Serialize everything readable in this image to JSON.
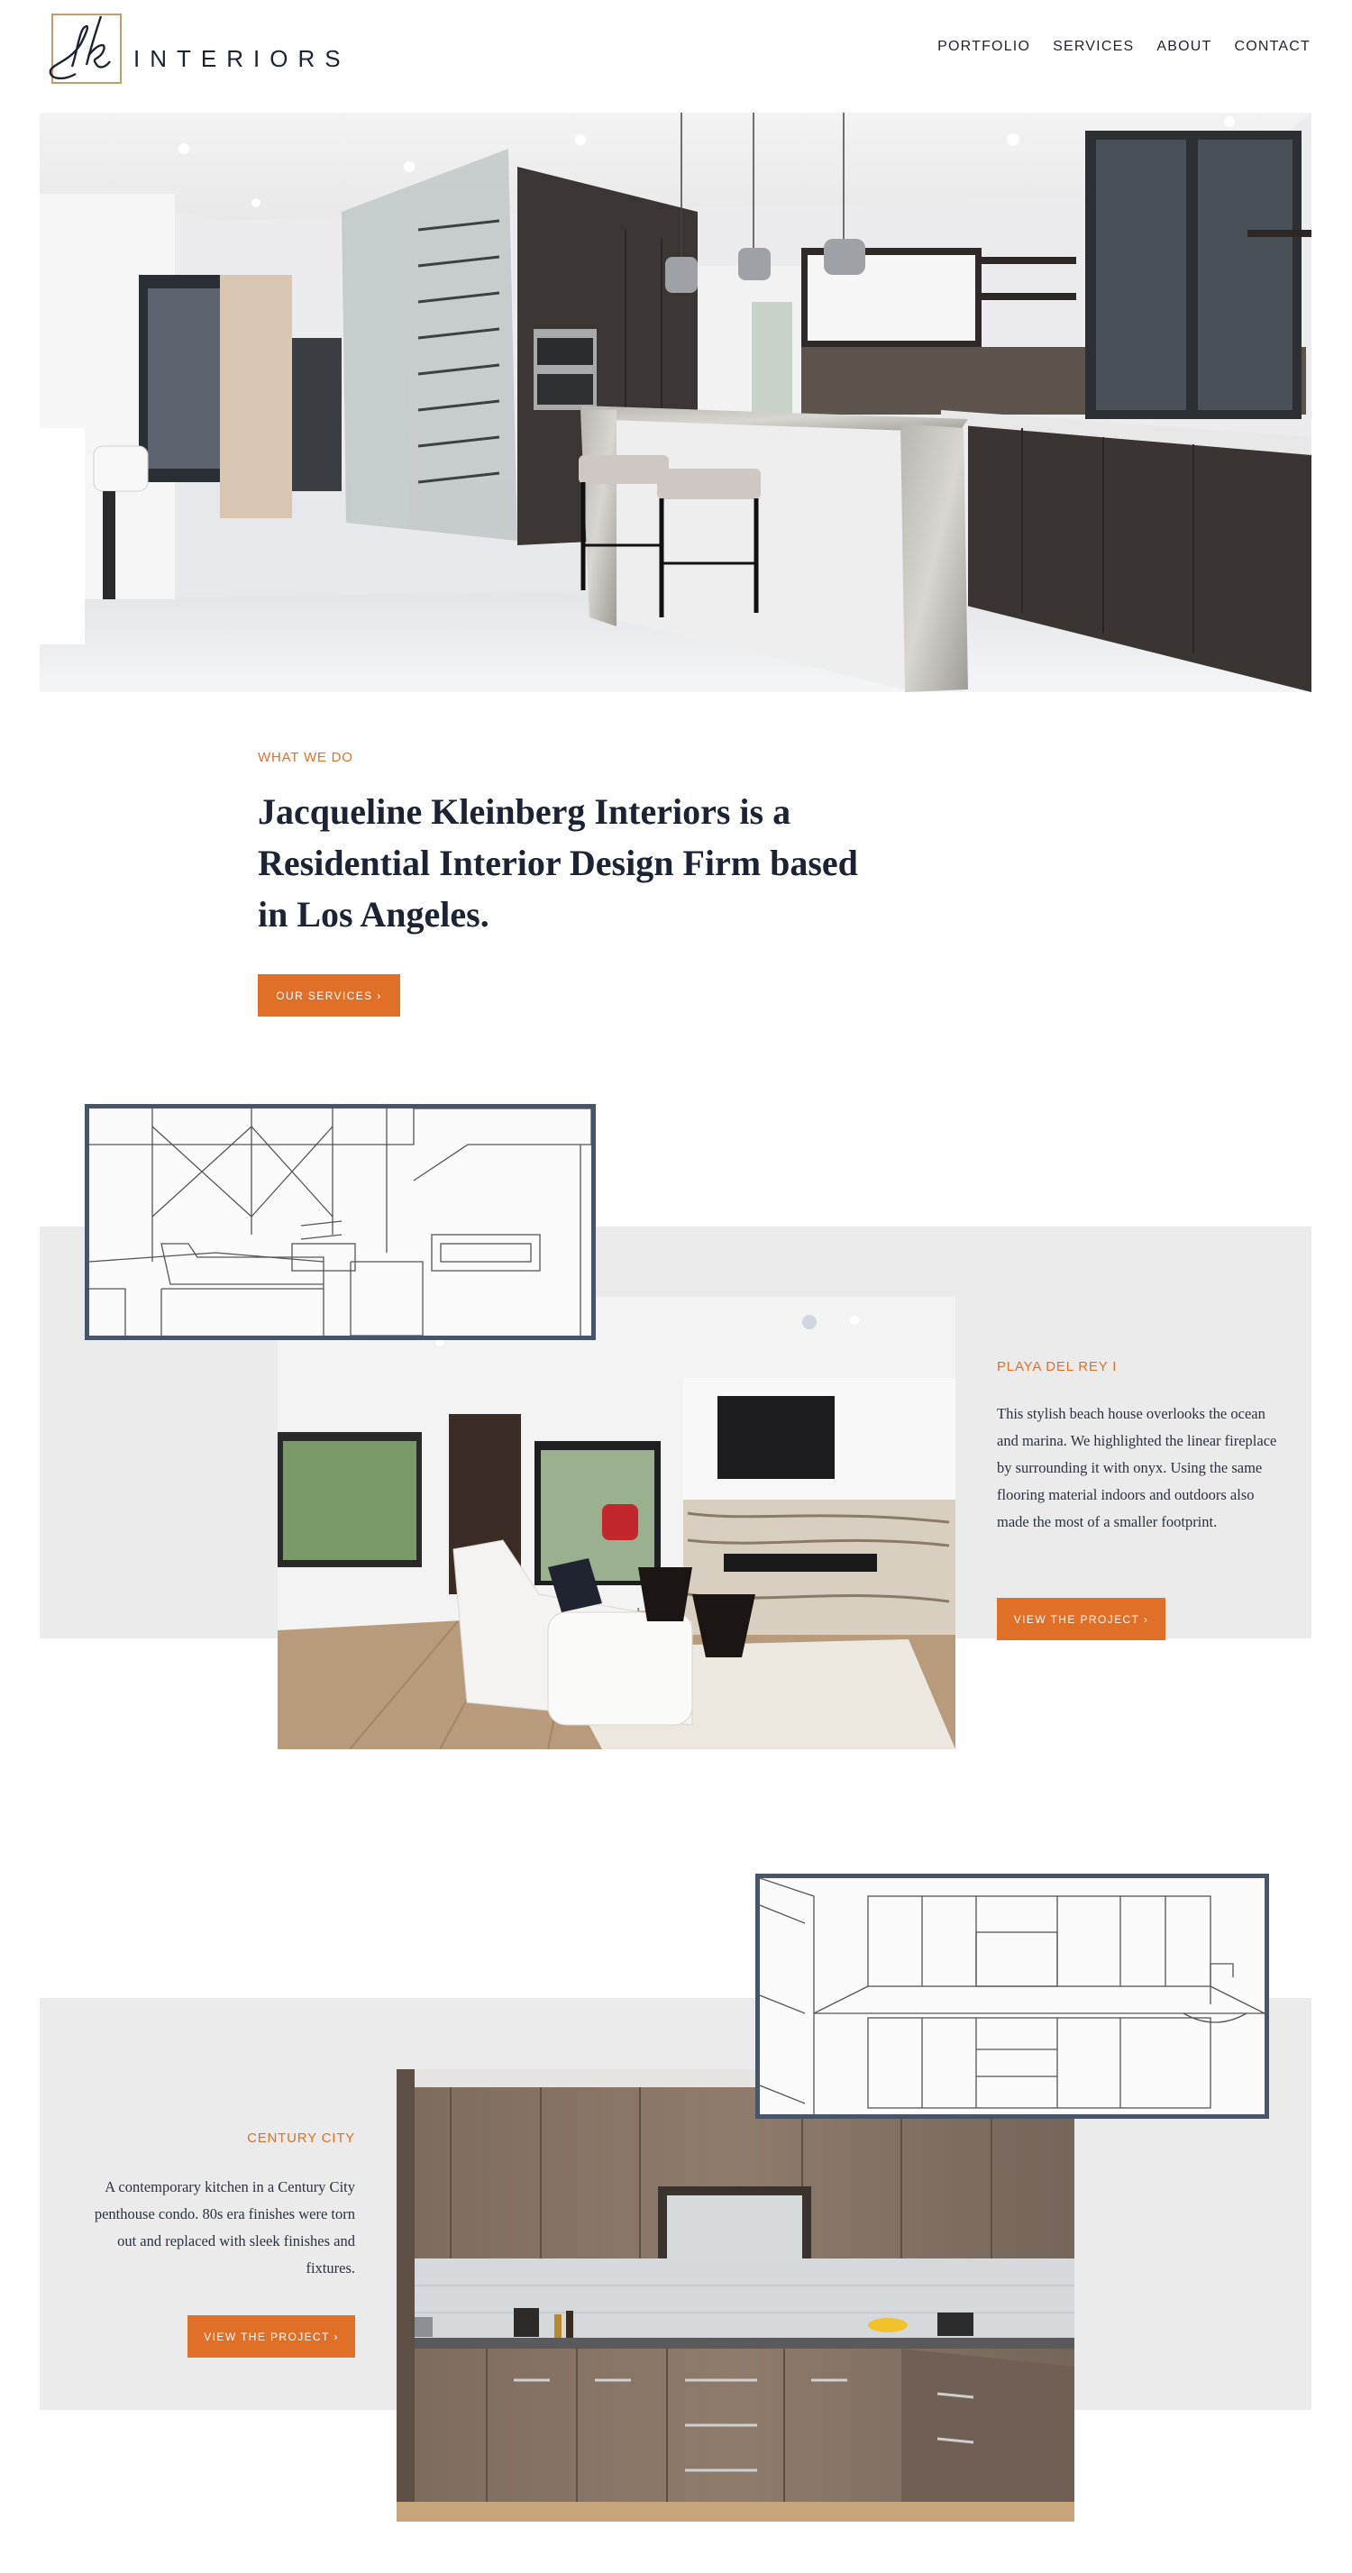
{
  "header": {
    "logo_mark": "jk",
    "logo_word": "INTERIORS",
    "nav": [
      "PORTFOLIO",
      "SERVICES",
      "ABOUT",
      "CONTACT"
    ]
  },
  "intro": {
    "eyebrow": "WHAT WE DO",
    "headline": "Jacqueline Kleinberg Interiors is a Residential Interior Design Firm based in Los Angeles.",
    "button": "OUR SERVICES ›"
  },
  "projects": [
    {
      "eyebrow": "PLAYA DEL REY I",
      "body": "This stylish beach house overlooks the ocean and marina. We highlighted the linear fireplace by surrounding it with onyx. Using the same flooring material indoors and outdoors also made the most of a smaller footprint.",
      "button": "VIEW THE PROJECT ›"
    },
    {
      "eyebrow": "CENTURY CITY",
      "body": "A contemporary kitchen in a Century City penthouse condo. 80s era finishes were torn out and replaced with sleek finishes and fixtures.",
      "button": "VIEW THE PROJECT ›"
    }
  ],
  "colors": {
    "accent": "#e06f28",
    "navy": "#1c2333",
    "band": "#ebebec",
    "sketch_frame": "#47546a",
    "logo_gold": "#c79a6a"
  }
}
